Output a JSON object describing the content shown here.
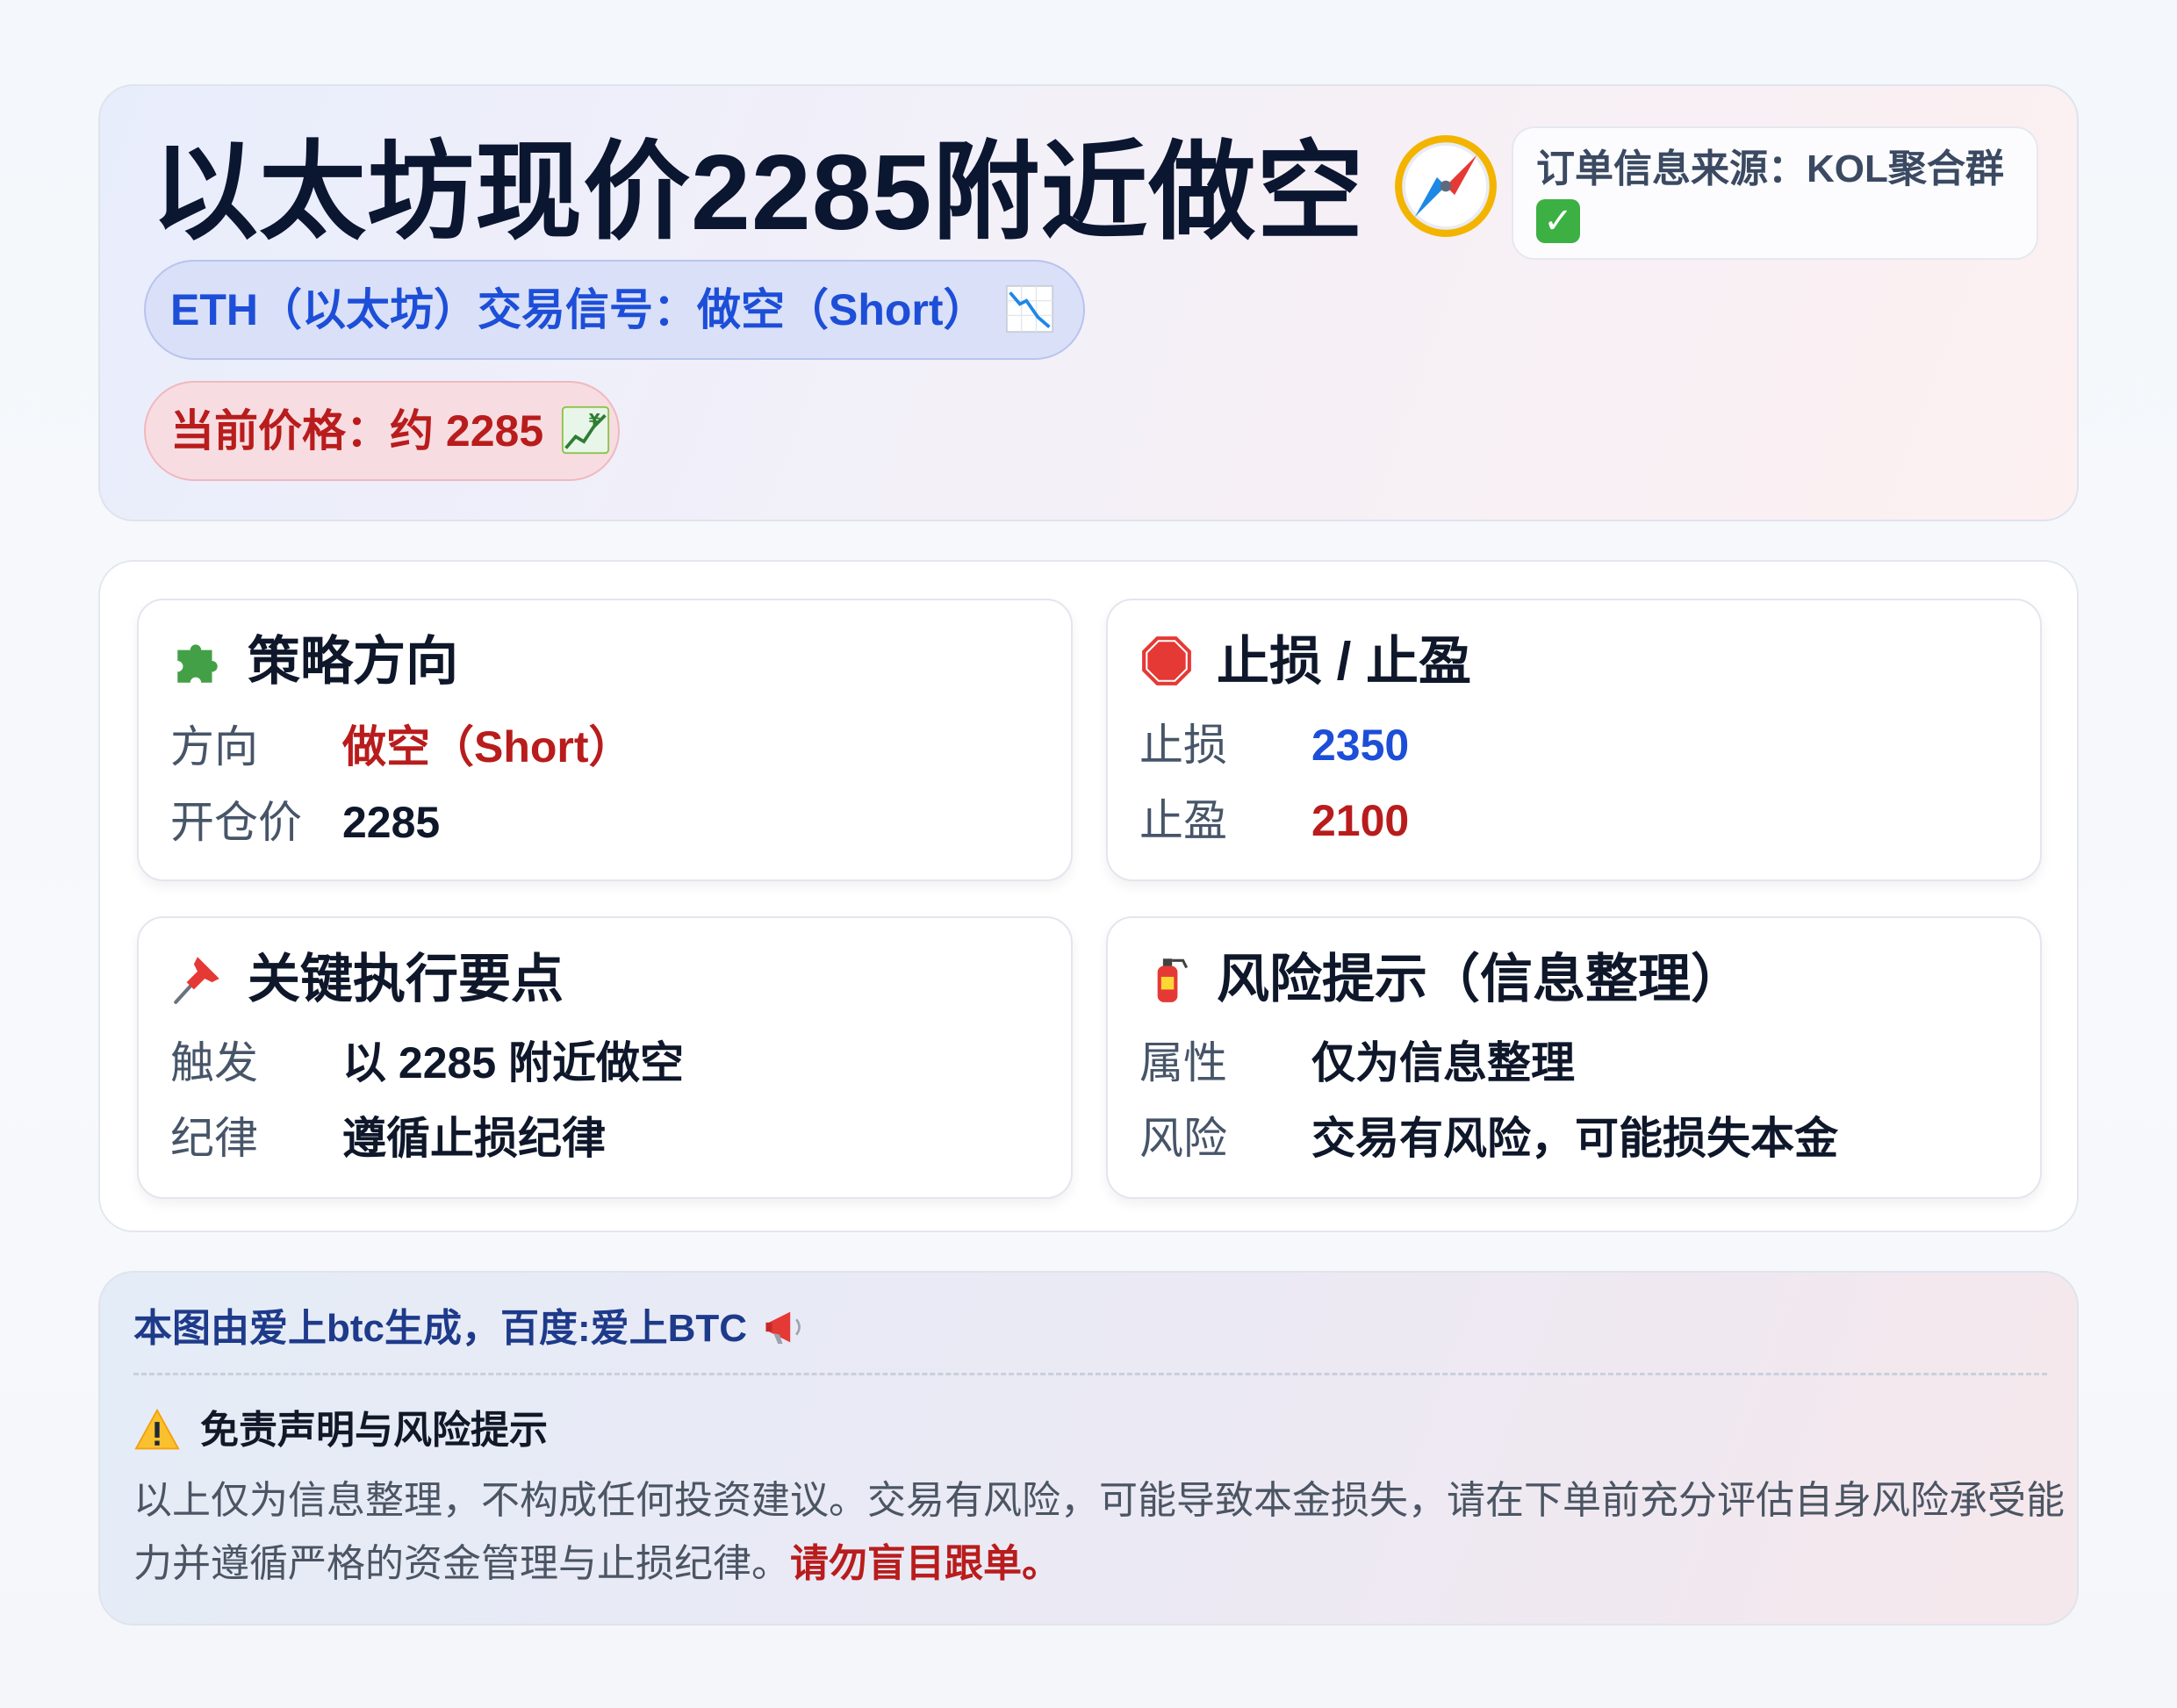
{
  "header": {
    "title": "以太坊现价2285附近做空",
    "title_icon": "compass-icon",
    "source_text": "订单信息来源：KOL聚合群",
    "source_icon": "check-mark-icon",
    "signal_pill": "ETH（以太坊）交易信号：做空（Short）",
    "signal_icon": "chart-decreasing-icon",
    "price_pill": "当前价格：约 2285",
    "price_icon": "chart-increasing-yen-icon"
  },
  "cards": {
    "strategy": {
      "title": "策略方向",
      "icon": "puzzle-piece-icon",
      "rows": [
        {
          "label": "方向",
          "value": "做空（Short）"
        },
        {
          "label": "开仓价",
          "value": "2285"
        }
      ]
    },
    "stops": {
      "title": "止损 / 止盈",
      "icon": "stop-sign-icon",
      "rows": [
        {
          "label": "止损",
          "value": "2350"
        },
        {
          "label": "止盈",
          "value": "2100"
        }
      ]
    },
    "execution": {
      "title": "关键执行要点",
      "icon": "pushpin-icon",
      "rows": [
        {
          "label": "触发",
          "value": "以 2285 附近做空"
        },
        {
          "label": "纪律",
          "value": "遵循止损纪律"
        }
      ]
    },
    "risk": {
      "title": "风险提示（信息整理）",
      "icon": "fire-extinguisher-icon",
      "rows": [
        {
          "label": "属性",
          "value": "仅为信息整理"
        },
        {
          "label": "风险",
          "value": "交易有风险，可能损失本金"
        }
      ]
    }
  },
  "footer": {
    "credit": "本图由爱上btc生成，百度:爱上BTC",
    "credit_icon": "megaphone-icon",
    "disclaimer_title": "免责声明与风险提示",
    "disclaimer_icon": "warning-icon",
    "disclaimer_text": "以上仅为信息整理，不构成任何投资建议。交易有风险，可能导致本金损失，请在下单前充分评估自身风险承受能力并遵循严格的资金管理与止损纪律。",
    "disclaimer_emphasis": "请勿盲目跟单。"
  },
  "colors": {
    "accent_blue": "#1d4ed8",
    "accent_red": "#b91c1c",
    "title_dark": "#0b1631"
  }
}
